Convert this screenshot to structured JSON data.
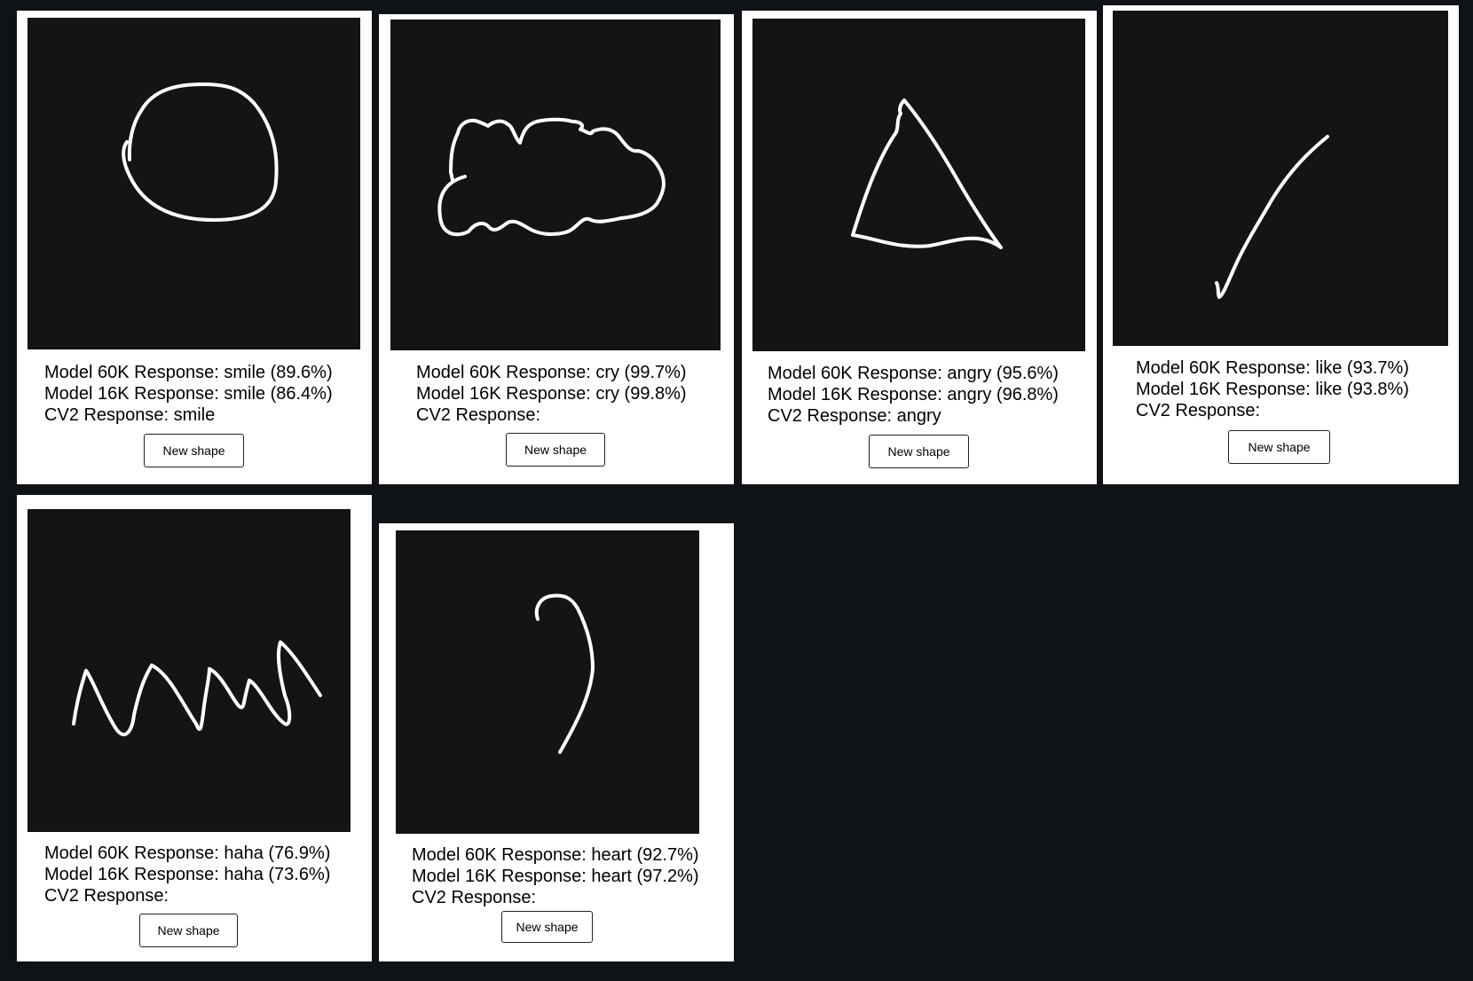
{
  "cards": [
    {
      "shape": "circle",
      "model_60k": "Model 60K Response: smile (89.6%)",
      "model_16k": "Model 16K Response: smile (86.4%)",
      "cv2": "CV2 Response: smile",
      "button": "New shape"
    },
    {
      "shape": "cloud",
      "model_60k": "Model 60K Response: cry (99.7%)",
      "model_16k": "Model 16K Response: cry (99.8%)",
      "cv2": "CV2 Response:",
      "button": "New shape"
    },
    {
      "shape": "triangle",
      "model_60k": "Model 60K Response: angry (95.6%)",
      "model_16k": "Model 16K Response: angry (96.8%)",
      "cv2": "CV2 Response: angry",
      "button": "New shape"
    },
    {
      "shape": "check",
      "model_60k": "Model 60K Response: like (93.7%)",
      "model_16k": "Model 16K Response: like (93.8%)",
      "cv2": "CV2 Response:",
      "button": "New shape"
    },
    {
      "shape": "zigzag",
      "model_60k": "Model 60K Response: haha (76.9%)",
      "model_16k": "Model 16K Response: haha (73.6%)",
      "cv2": "CV2 Response:",
      "button": "New shape"
    },
    {
      "shape": "curve",
      "model_60k": "Model 60K Response: heart (92.7%)",
      "model_16k": "Model 16K Response: heart (97.2%)",
      "cv2": "CV2 Response:",
      "button": "New shape"
    }
  ],
  "colors": {
    "page_background": "#0f1217",
    "card_background": "#ffffff",
    "canvas_background": "#141414",
    "stroke": "#ffffff"
  }
}
